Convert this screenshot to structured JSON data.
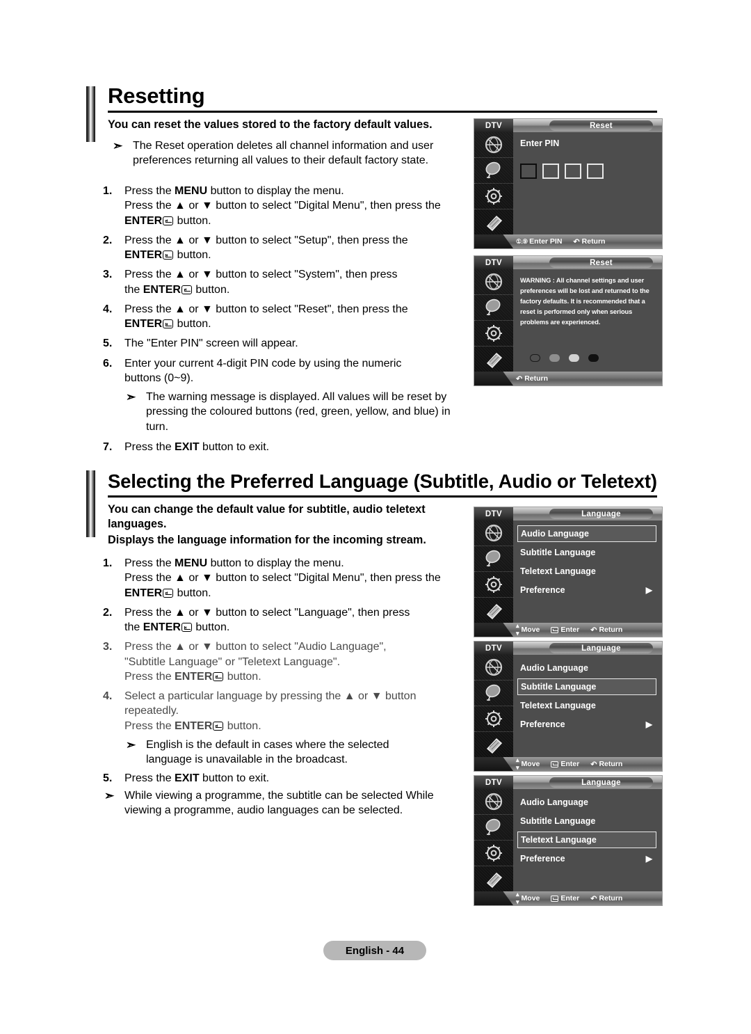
{
  "sections": [
    {
      "title": "Resetting",
      "lead": "You can reset the values stored to the factory default values.",
      "note": "The Reset operation deletes all channel information and user preferences returning all values to their default factory state.",
      "steps": [
        {
          "n": "1.",
          "lines": [
            "Press the MENU button to display the menu.",
            "Press the ▲ or ▼ button to select \"Digital Menu\", then press the",
            "ENTER↵ button."
          ]
        },
        {
          "n": "2.",
          "lines": [
            "Press the ▲ or ▼ button to select \"Setup\", then press the",
            "ENTER↵ button."
          ]
        },
        {
          "n": "3.",
          "lines": [
            "Press the ▲ or ▼ button to select \"System\", then press",
            "the ENTER↵ button."
          ]
        },
        {
          "n": "4.",
          "lines": [
            "Press the ▲ or ▼ button to select \"Reset\", then press the",
            "ENTER↵ button."
          ]
        },
        {
          "n": "5.",
          "lines": [
            "The \"Enter PIN\" screen will appear."
          ]
        },
        {
          "n": "6.",
          "lines": [
            "Enter your current 4-digit PIN code by using the numeric",
            "buttons (0~9)."
          ]
        }
      ],
      "subnote": "The warning message is displayed. All values will be reset by pressing the coloured buttons (red, green, yellow, and blue) in turn.",
      "last_step": {
        "n": "7.",
        "lines": [
          "Press the EXIT button to exit."
        ]
      }
    },
    {
      "title": "Selecting the Preferred Language (Subtitle, Audio or Teletext)",
      "lead1": "You can change the default value for subtitle, audio teletext languages.",
      "lead2": "Displays the language information for the incoming stream.",
      "steps": [
        {
          "n": "1.",
          "lines": [
            "Press the MENU button to display the menu.",
            "Press the ▲ or ▼ button to select \"Digital Menu\", then press the",
            "ENTER↵ button."
          ]
        },
        {
          "n": "2.",
          "lines": [
            "Press the ▲ or ▼ button to select \"Language\", then press",
            "the ENTER↵ button."
          ]
        },
        {
          "n": "3.",
          "lines": [
            "Press the ▲ or ▼ button to select \"Audio Language\",",
            "\"Subtitle Language\" or \"Teletext Language\".",
            "Press the ENTER↵ button."
          ]
        },
        {
          "n": "4.",
          "lines": [
            "Select a particular language by pressing the ▲ or ▼ button",
            "repeatedly.",
            "Press the ENTER↵ button."
          ]
        }
      ],
      "subnote": "English is the default in cases where the selected language is unavailable in the broadcast.",
      "last_step": {
        "n": "5.",
        "lines": [
          "Press the EXIT button to exit."
        ]
      },
      "endnote": "While viewing a programme, the subtitle can be selected While viewing a programme, audio languages can be selected."
    }
  ],
  "osd": {
    "source_label": "DTV",
    "icons": [
      "broadcast-icon",
      "satellite-dish-icon",
      "gear-setup-icon",
      "remote-hand-icon"
    ],
    "screens": [
      {
        "id": "reset-pin",
        "title": "Reset",
        "label": "Enter PIN",
        "pins": [
          "",
          "",
          "",
          ""
        ],
        "footer": [
          {
            "glyph": "0~9",
            "label": "Enter PIN"
          },
          {
            "glyph": "↺",
            "label": "Return"
          }
        ]
      },
      {
        "id": "reset-warning",
        "title": "Reset",
        "warning": "WARNING : All channel settings and user preferences will be lost and returned to the factory defaults. It is recommended that a reset is performed only when serious problems are experienced.",
        "colour_buttons": [
          "red",
          "green",
          "yellow",
          "blue"
        ],
        "footer": [
          {
            "glyph": "↺",
            "label": "Return"
          }
        ]
      },
      {
        "id": "language-audio",
        "title": "Language",
        "items": [
          {
            "label": "Audio Language",
            "selected": true,
            "caret": ""
          },
          {
            "label": "Subtitle Language",
            "selected": false,
            "caret": ""
          },
          {
            "label": "Teletext Language",
            "selected": false,
            "caret": ""
          },
          {
            "label": "Preference",
            "selected": false,
            "caret": "▶"
          }
        ],
        "footer": [
          {
            "glyph": "↕",
            "label": "Move"
          },
          {
            "glyph": "enter",
            "label": "Enter"
          },
          {
            "glyph": "↺",
            "label": "Return"
          }
        ]
      },
      {
        "id": "language-subtitle",
        "title": "Language",
        "items": [
          {
            "label": "Audio Language",
            "selected": false,
            "caret": ""
          },
          {
            "label": "Subtitle Language",
            "selected": true,
            "caret": ""
          },
          {
            "label": "Teletext Language",
            "selected": false,
            "caret": ""
          },
          {
            "label": "Preference",
            "selected": false,
            "caret": "▶"
          }
        ],
        "footer": [
          {
            "glyph": "↕",
            "label": "Move"
          },
          {
            "glyph": "enter",
            "label": "Enter"
          },
          {
            "glyph": "↺",
            "label": "Return"
          }
        ]
      },
      {
        "id": "language-teletext",
        "title": "Language",
        "items": [
          {
            "label": "Audio Language",
            "selected": false,
            "caret": ""
          },
          {
            "label": "Subtitle Language",
            "selected": false,
            "caret": ""
          },
          {
            "label": "Teletext Language",
            "selected": true,
            "caret": ""
          },
          {
            "label": "Preference",
            "selected": false,
            "caret": "▶"
          }
        ],
        "footer": [
          {
            "glyph": "↕",
            "label": "Move"
          },
          {
            "glyph": "enter",
            "label": "Enter"
          },
          {
            "glyph": "↺",
            "label": "Return"
          }
        ]
      }
    ]
  },
  "page_footer": "English - 44"
}
